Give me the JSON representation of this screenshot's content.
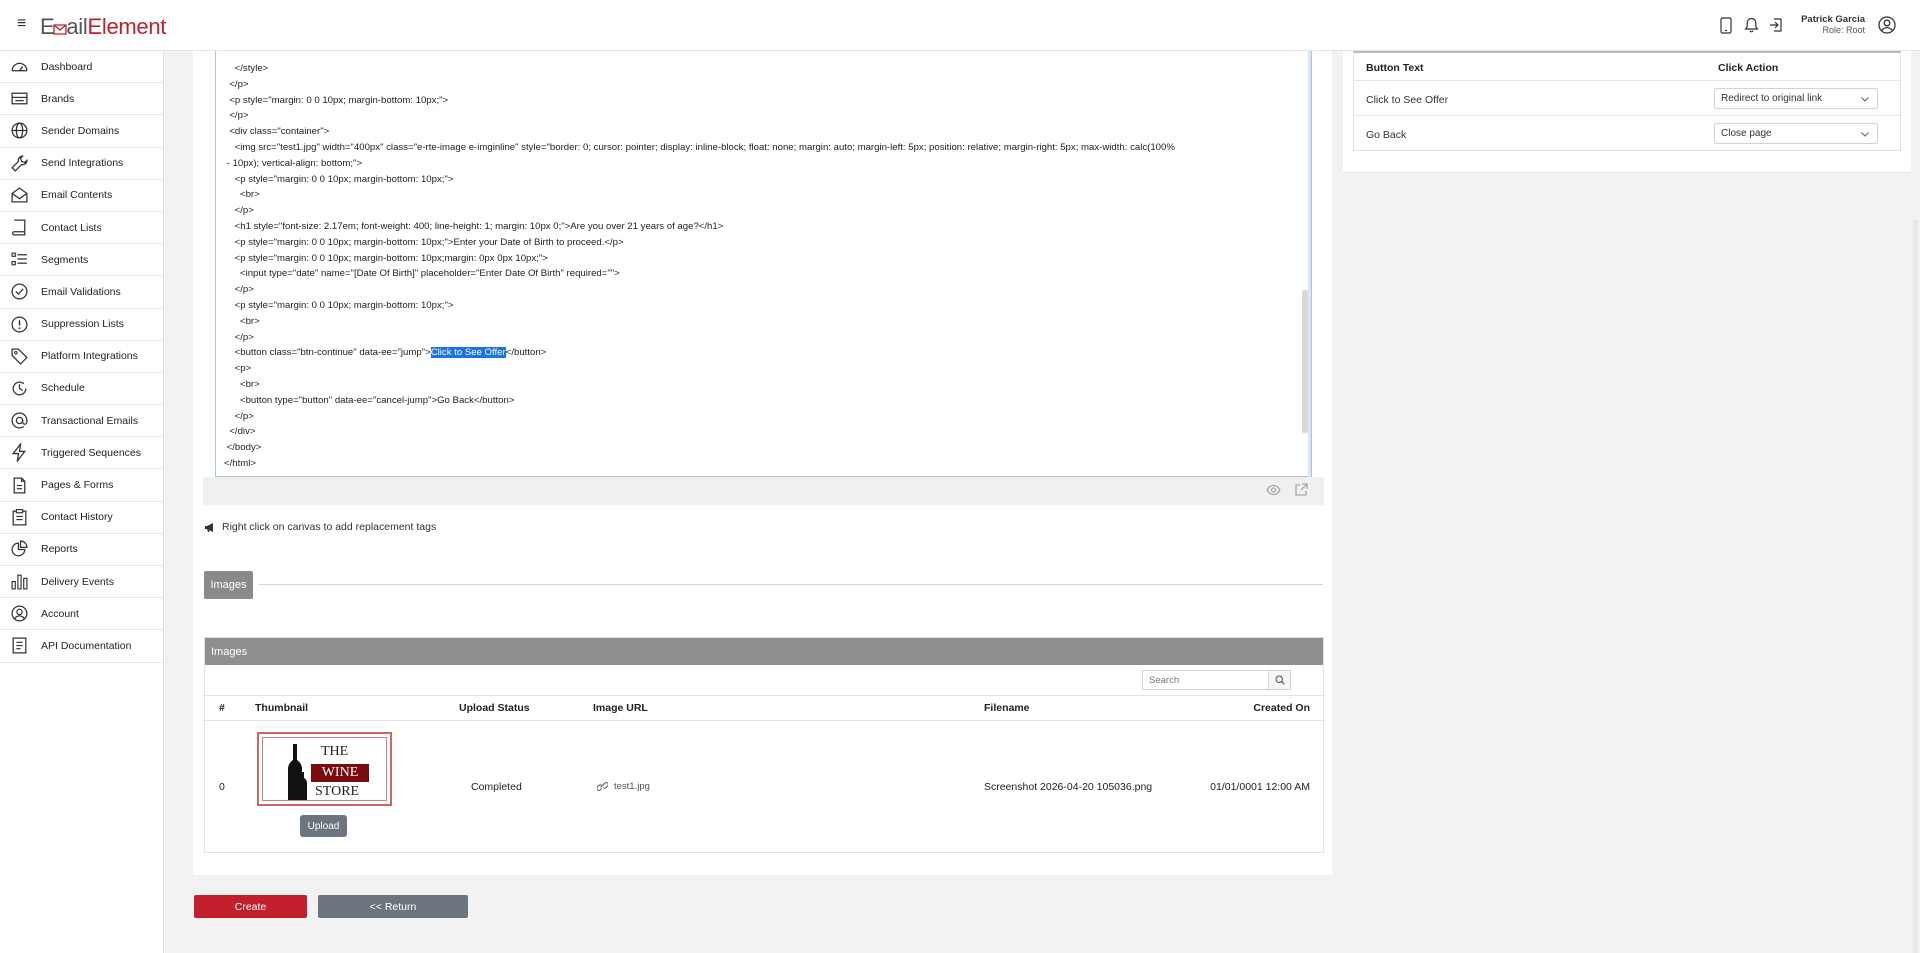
{
  "header": {
    "logo_prefix": "E",
    "logo_mid": "ail",
    "logo_suffix": "Element",
    "user_name": "Patrick Garcia",
    "user_role": "Role: Root"
  },
  "sidebar": {
    "items": [
      {
        "label": "Dashboard",
        "icon": "dashboard-icon"
      },
      {
        "label": "Brands",
        "icon": "brands-icon"
      },
      {
        "label": "Sender Domains",
        "icon": "globe-icon"
      },
      {
        "label": "Send Integrations",
        "icon": "wrench-icon"
      },
      {
        "label": "Email Contents",
        "icon": "envelope-icon"
      },
      {
        "label": "Contact Lists",
        "icon": "book-icon"
      },
      {
        "label": "Segments",
        "icon": "list-icon"
      },
      {
        "label": "Email Validations",
        "icon": "check-circle-icon"
      },
      {
        "label": "Suppression Lists",
        "icon": "exclamation-circle-icon"
      },
      {
        "label": "Platform Integrations",
        "icon": "tag-icon"
      },
      {
        "label": "Schedule",
        "icon": "clock-icon"
      },
      {
        "label": "Transactional Emails",
        "icon": "at-icon"
      },
      {
        "label": "Triggered Sequences",
        "icon": "lightning-icon"
      },
      {
        "label": "Pages & Forms",
        "icon": "clipboard-icon"
      },
      {
        "label": "Contact History",
        "icon": "clipboard-list-icon"
      },
      {
        "label": "Reports",
        "icon": "pie-chart-icon"
      },
      {
        "label": "Delivery Events",
        "icon": "bar-chart-icon"
      },
      {
        "label": "Account",
        "icon": "user-circle-icon"
      },
      {
        "label": "API Documentation",
        "icon": "document-icon"
      }
    ]
  },
  "editor": {
    "lines": [
      "    </style>",
      "  </p>",
      "  <p style=\"margin: 0 0 10px; margin-bottom: 10px;\">",
      "  </p>",
      "  <div class=\"container\">",
      "    <img src=\"test1.jpg\" width=\"400px\" class=\"e-rte-image e-imginline\" style=\"border: 0; cursor: pointer; display: inline-block; float: none; margin: auto; margin-left: 5px; position: relative; margin-right: 5px; max-width: calc(100%",
      " - 10px); vertical-align: bottom;\">",
      "    <p style=\"margin: 0 0 10px; margin-bottom: 10px;\">",
      "      <br>",
      "    </p>",
      "    <h1 style=\"font-size: 2.17em; font-weight: 400; line-height: 1; margin: 10px 0;\">Are you over 21 years of age?</h1>",
      "    <p style=\"margin: 0 0 10px; margin-bottom: 10px;\">Enter your Date of Birth to proceed.</p>",
      "    <p style=\"margin: 0 0 10px; margin-bottom: 10px;margin: 0px 0px 10px;\">",
      "      <input type=\"date\" name=\"[Date Of Birth]\" placeholder=\"Enter Date Of Birth\" required=\"\">",
      "    </p>",
      "    <p style=\"margin: 0 0 10px; margin-bottom: 10px;\">",
      "      <br>",
      "    </p>",
      "    <button class=\"btn-continue\" data-ee=\"jump\">",
      "    <p>",
      "      <br>",
      "      <button type=\"button\" data-ee=\"cancel-jump\">Go Back</button>",
      "    </p>",
      "  </div>",
      " </body>",
      "</html>"
    ],
    "selected_text": "Click to See Offer",
    "button_close": "</button>"
  },
  "hint": "Right click on canvas to add replacement tags",
  "images_tab": "Images",
  "images_panel": {
    "title": "Images",
    "search_placeholder": "Search",
    "columns": [
      "#",
      "Thumbnail",
      "Upload Status",
      "Image URL",
      "Filename",
      "Created On"
    ],
    "rows": [
      {
        "index": "0",
        "status": "Completed",
        "url": "test1.jpg",
        "filename": "Screenshot 2026-04-20 105036.png",
        "created": "01/01/0001 12:00 AM",
        "thumb_lines": [
          "THE",
          "WINE",
          "STORE"
        ]
      }
    ],
    "upload_label": "Upload"
  },
  "actions": {
    "create": "Create",
    "return": "<< Return"
  },
  "button_table": {
    "col_text": "Button Text",
    "col_action": "Click Action",
    "rows": [
      {
        "text": "Click to See Offer",
        "action": "Redirect to original link"
      },
      {
        "text": "Go Back",
        "action": "Close page"
      }
    ]
  },
  "colors": {
    "brand": "#c41f2c",
    "selection": "#1a73e8",
    "panel_header": "#8f8f8f",
    "secondary_button": "#6c757d"
  }
}
